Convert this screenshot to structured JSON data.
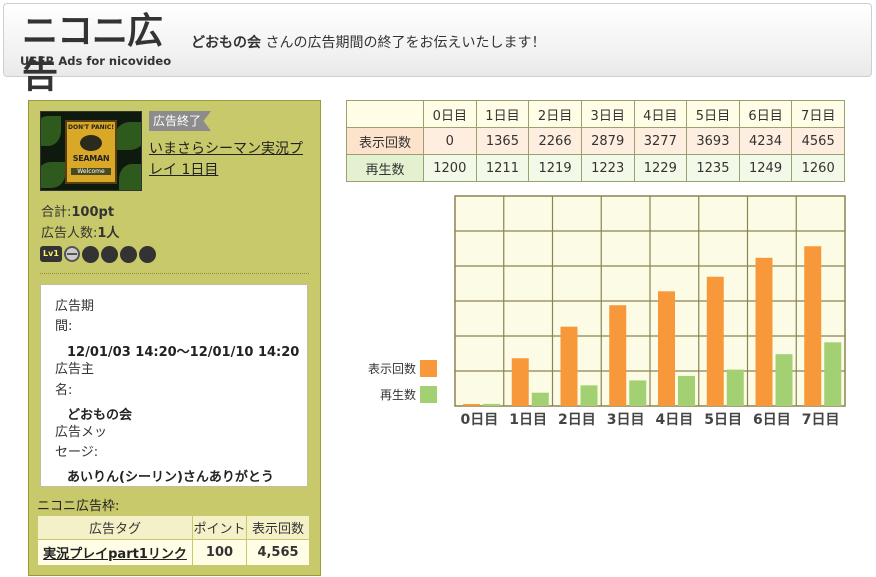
{
  "header": {
    "logo_main": "ニコニ広告",
    "logo_sub": "USER Ads for nicovideo",
    "user_name": "どおもの会",
    "message": "さんの広告期間の終了をお伝えいたします！"
  },
  "ad": {
    "status_tag": "広告終了",
    "video_title": "いまさらシーマン実況プレイ 1日目",
    "thumbnail": {
      "line1": "DON'T PANIC!",
      "line2": "SEAMAN",
      "line3": "Welcome"
    },
    "total_label": "合計:",
    "total_value": "100pt",
    "people_label": "広告人数:",
    "people_value": "1人",
    "level_badge": "Lv1",
    "period_label_1": "広告期",
    "period_label_2": "間:",
    "period_value": "12/01/03 14:20～12/01/10 14:20",
    "sponsor_label_1": "広告主",
    "sponsor_label_2": "名:",
    "sponsor_value": "どおもの会",
    "message_label_1": "広告メッ",
    "message_label_2": "セージ:",
    "message_value": "あいりん(シーリン)さんありがとう"
  },
  "frames": {
    "title": "ニコニ広告枠:",
    "headers": [
      "広告タグ",
      "ポイント",
      "表示回数"
    ],
    "rows": [
      [
        "実況プレイpart1リンク",
        "100",
        "4,565"
      ]
    ]
  },
  "stats": {
    "days": [
      "0日目",
      "1日目",
      "2日目",
      "3日目",
      "4日目",
      "5日目",
      "6日目",
      "7日目"
    ],
    "impressions_label": "表示回数",
    "impressions": [
      "0",
      "1365",
      "2266",
      "2879",
      "3277",
      "3693",
      "4234",
      "4565"
    ],
    "plays_label": "再生数",
    "plays": [
      "1200",
      "1211",
      "1219",
      "1223",
      "1229",
      "1235",
      "1249",
      "1260"
    ]
  },
  "chart_data": {
    "type": "bar",
    "categories": [
      "0日目",
      "1日目",
      "2日目",
      "3日目",
      "4日目",
      "5日目",
      "6日目",
      "7日目"
    ],
    "series": [
      {
        "name": "表示回数",
        "color": "#f7993a",
        "values": [
          0,
          1365,
          2266,
          2879,
          3277,
          3693,
          4234,
          4565
        ]
      },
      {
        "name": "再生数",
        "color": "#a3d072",
        "values": [
          60,
          380,
          590,
          730,
          860,
          1040,
          1480,
          1820
        ]
      }
    ],
    "ylim": [
      0,
      6000
    ],
    "grid": true,
    "legend": "left"
  },
  "colors": {
    "panel": "#c8c96a",
    "chart_bg": "#fcfce6",
    "grid": "#8b8350"
  }
}
